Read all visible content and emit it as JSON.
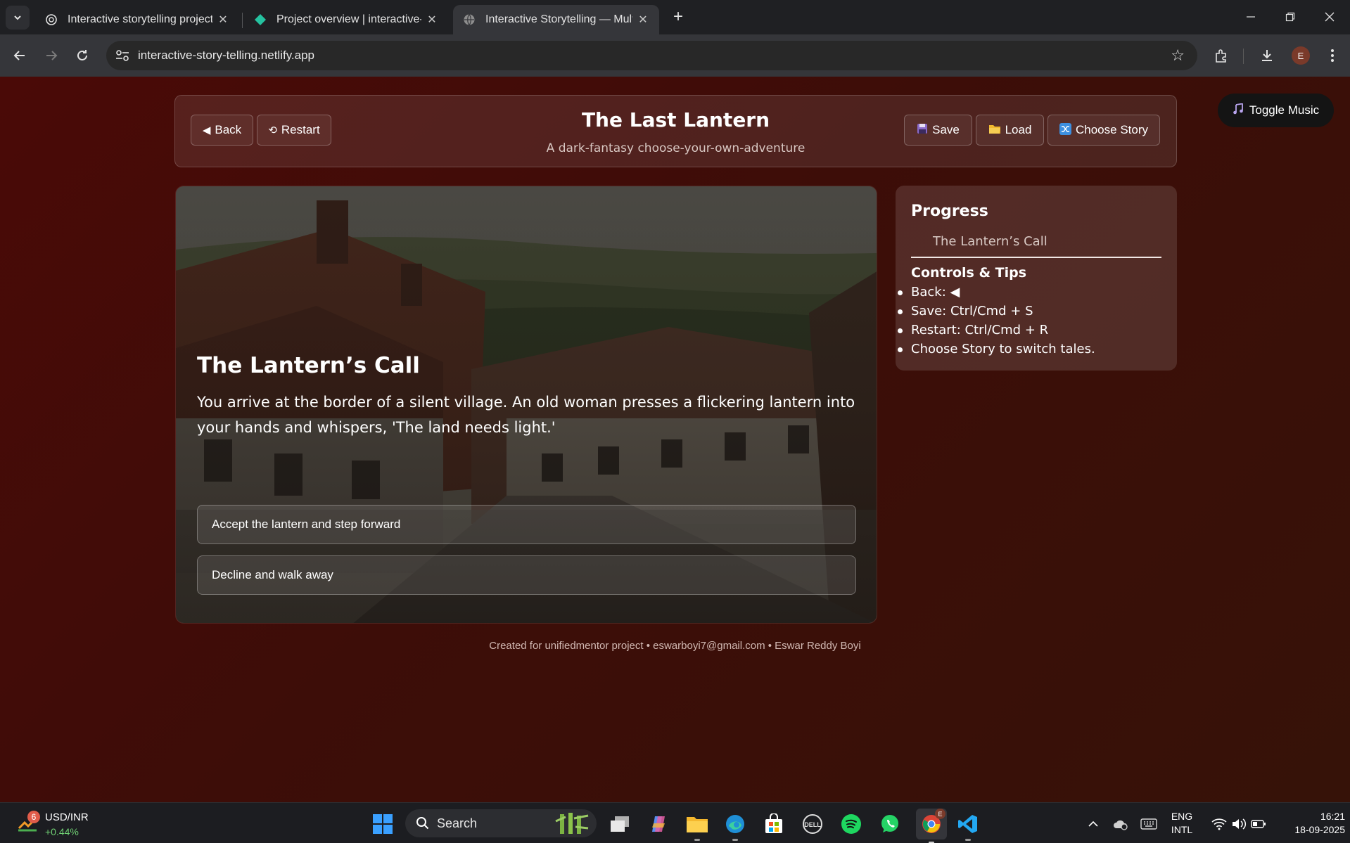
{
  "browser": {
    "tabs": [
      {
        "title": "Interactive storytelling project",
        "active": false
      },
      {
        "title": "Project overview | interactive-st",
        "active": false
      },
      {
        "title": "Interactive Storytelling — Multi",
        "active": true
      }
    ],
    "url": "interactive-story-telling.netlify.app",
    "profile_initial": "E"
  },
  "page": {
    "header": {
      "back_label": "Back",
      "restart_label": "Restart",
      "title": "The Last Lantern",
      "subtitle": "A dark-fantasy choose-your-own-adventure",
      "save_label": "Save",
      "load_label": "Load",
      "choose_story_label": "Choose Story"
    },
    "music_label": "Toggle Music",
    "scene": {
      "heading": "The Lantern’s Call",
      "text": "You arrive at the border of a silent village. An old woman presses a flickering lantern into your hands and whispers, 'The land needs light.'",
      "choices": [
        "Accept the lantern and step forward",
        "Decline and walk away"
      ]
    },
    "progress": {
      "title": "Progress",
      "items": [
        "The Lantern’s Call"
      ],
      "tips_title": "Controls & Tips",
      "tips": [
        "Back: ◀",
        "Save: Ctrl/Cmd + S",
        "Restart: Ctrl/Cmd + R",
        "Choose Story to switch tales."
      ]
    },
    "footer": "Created for unifiedmentor project • eswarboyi7@gmail.com • Eswar Reddy Boyi"
  },
  "taskbar": {
    "widget_name": "USD/INR",
    "widget_change": "+0.44%",
    "widget_badge": "6",
    "search_label": "Search",
    "lang_line1": "ENG",
    "lang_line2": "INTL",
    "time": "16:21",
    "date": "18-09-2025",
    "chrome_badge": "E"
  }
}
